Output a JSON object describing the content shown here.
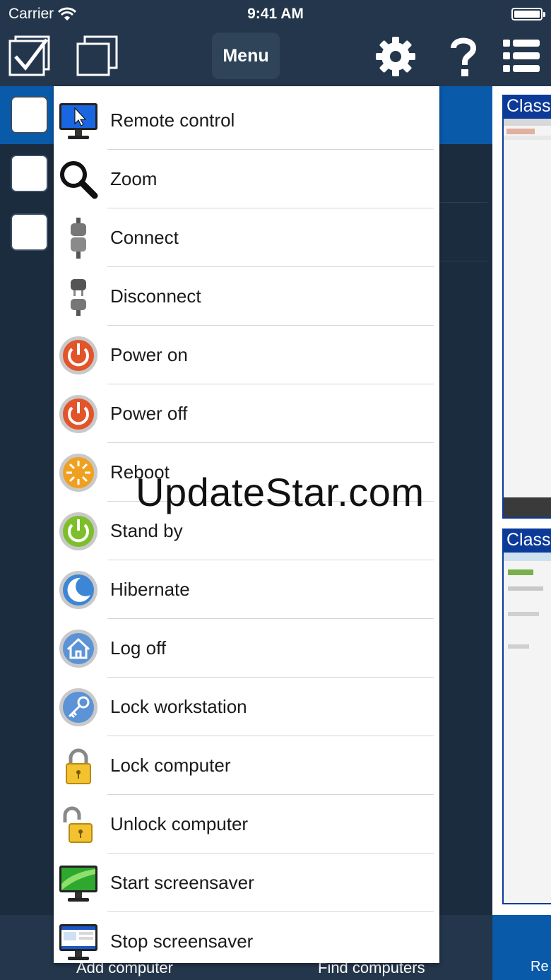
{
  "status_bar": {
    "carrier": "Carrier",
    "time": "9:41 AM"
  },
  "toolbar": {
    "menu_label": "Menu"
  },
  "bottom_bar": {
    "add_computer": "Add computer",
    "find_computers": "Find computers",
    "right_label": "Re"
  },
  "previews": [
    {
      "title": "Class"
    },
    {
      "title": "Class"
    }
  ],
  "menu": {
    "items": [
      {
        "label": "Remote control",
        "icon": "monitor-cursor-icon"
      },
      {
        "label": "Zoom",
        "icon": "magnifier-icon"
      },
      {
        "label": "Connect",
        "icon": "plug-connected-icon"
      },
      {
        "label": "Disconnect",
        "icon": "plug-disconnected-icon"
      },
      {
        "label": "Power on",
        "icon": "power-on-icon"
      },
      {
        "label": "Power off",
        "icon": "power-off-icon"
      },
      {
        "label": "Reboot",
        "icon": "reboot-icon"
      },
      {
        "label": "Stand by",
        "icon": "standby-icon"
      },
      {
        "label": "Hibernate",
        "icon": "hibernate-moon-icon"
      },
      {
        "label": "Log off",
        "icon": "logoff-house-icon"
      },
      {
        "label": "Lock workstation",
        "icon": "key-icon"
      },
      {
        "label": "Lock computer",
        "icon": "padlock-closed-icon"
      },
      {
        "label": "Unlock computer",
        "icon": "padlock-open-icon"
      },
      {
        "label": "Start screensaver",
        "icon": "screensaver-start-icon"
      },
      {
        "label": "Stop screensaver",
        "icon": "screensaver-stop-icon"
      }
    ]
  },
  "watermark": "UpdateStar.com",
  "colors": {
    "bar_bg": "#24364b",
    "selected_row": "#0a5aaa",
    "panel_bg": "#1c2c3f",
    "thumb_title": "#0b3a99"
  }
}
